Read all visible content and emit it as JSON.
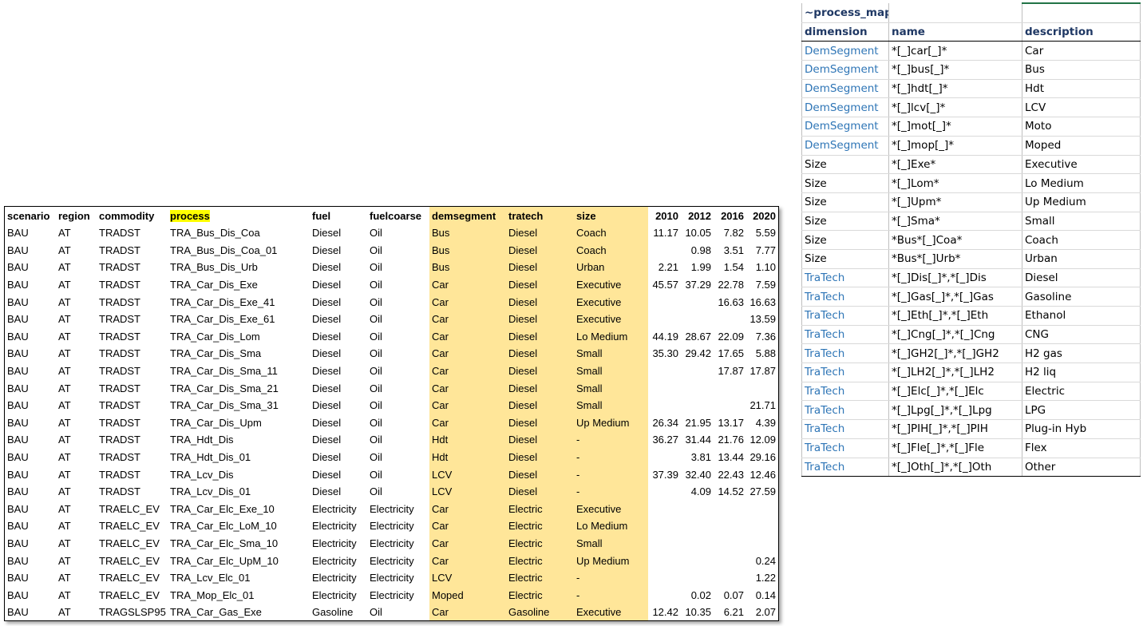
{
  "left_table": {
    "headers": [
      "scenario",
      "region",
      "commodity",
      "process",
      "fuel",
      "fuelcoarse",
      "demsegment",
      "tratech",
      "size",
      "2010",
      "2012",
      "2016",
      "2020"
    ],
    "rows": [
      [
        "BAU",
        "AT",
        "TRADST",
        "TRA_Bus_Dis_Coa",
        "Diesel",
        "Oil",
        "Bus",
        "Diesel",
        "Coach",
        "11.17",
        "10.05",
        "7.82",
        "5.59"
      ],
      [
        "BAU",
        "AT",
        "TRADST",
        "TRA_Bus_Dis_Coa_01",
        "Diesel",
        "Oil",
        "Bus",
        "Diesel",
        "Coach",
        "",
        "0.98",
        "3.51",
        "7.77"
      ],
      [
        "BAU",
        "AT",
        "TRADST",
        "TRA_Bus_Dis_Urb",
        "Diesel",
        "Oil",
        "Bus",
        "Diesel",
        "Urban",
        "2.21",
        "1.99",
        "1.54",
        "1.10"
      ],
      [
        "BAU",
        "AT",
        "TRADST",
        "TRA_Car_Dis_Exe",
        "Diesel",
        "Oil",
        "Car",
        "Diesel",
        "Executive",
        "45.57",
        "37.29",
        "22.78",
        "7.59"
      ],
      [
        "BAU",
        "AT",
        "TRADST",
        "TRA_Car_Dis_Exe_41",
        "Diesel",
        "Oil",
        "Car",
        "Diesel",
        "Executive",
        "",
        "",
        "16.63",
        "16.63"
      ],
      [
        "BAU",
        "AT",
        "TRADST",
        "TRA_Car_Dis_Exe_61",
        "Diesel",
        "Oil",
        "Car",
        "Diesel",
        "Executive",
        "",
        "",
        "",
        "13.59"
      ],
      [
        "BAU",
        "AT",
        "TRADST",
        "TRA_Car_Dis_Lom",
        "Diesel",
        "Oil",
        "Car",
        "Diesel",
        "Lo Medium",
        "44.19",
        "28.67",
        "22.09",
        "7.36"
      ],
      [
        "BAU",
        "AT",
        "TRADST",
        "TRA_Car_Dis_Sma",
        "Diesel",
        "Oil",
        "Car",
        "Diesel",
        "Small",
        "35.30",
        "29.42",
        "17.65",
        "5.88"
      ],
      [
        "BAU",
        "AT",
        "TRADST",
        "TRA_Car_Dis_Sma_11",
        "Diesel",
        "Oil",
        "Car",
        "Diesel",
        "Small",
        "",
        "",
        "17.87",
        "17.87"
      ],
      [
        "BAU",
        "AT",
        "TRADST",
        "TRA_Car_Dis_Sma_21",
        "Diesel",
        "Oil",
        "Car",
        "Diesel",
        "Small",
        "",
        "",
        "",
        ""
      ],
      [
        "BAU",
        "AT",
        "TRADST",
        "TRA_Car_Dis_Sma_31",
        "Diesel",
        "Oil",
        "Car",
        "Diesel",
        "Small",
        "",
        "",
        "",
        "21.71"
      ],
      [
        "BAU",
        "AT",
        "TRADST",
        "TRA_Car_Dis_Upm",
        "Diesel",
        "Oil",
        "Car",
        "Diesel",
        "Up Medium",
        "26.34",
        "21.95",
        "13.17",
        "4.39"
      ],
      [
        "BAU",
        "AT",
        "TRADST",
        "TRA_Hdt_Dis",
        "Diesel",
        "Oil",
        "Hdt",
        "Diesel",
        "-",
        "36.27",
        "31.44",
        "21.76",
        "12.09"
      ],
      [
        "BAU",
        "AT",
        "TRADST",
        "TRA_Hdt_Dis_01",
        "Diesel",
        "Oil",
        "Hdt",
        "Diesel",
        "-",
        "",
        "3.81",
        "13.44",
        "29.16"
      ],
      [
        "BAU",
        "AT",
        "TRADST",
        "TRA_Lcv_Dis",
        "Diesel",
        "Oil",
        "LCV",
        "Diesel",
        "-",
        "37.39",
        "32.40",
        "22.43",
        "12.46"
      ],
      [
        "BAU",
        "AT",
        "TRADST",
        "TRA_Lcv_Dis_01",
        "Diesel",
        "Oil",
        "LCV",
        "Diesel",
        "-",
        "",
        "4.09",
        "14.52",
        "27.59"
      ],
      [
        "BAU",
        "AT",
        "TRAELC_EV",
        "TRA_Car_Elc_Exe_10",
        "Electricity",
        "Electricity",
        "Car",
        "Electric",
        "Executive",
        "",
        "",
        "",
        ""
      ],
      [
        "BAU",
        "AT",
        "TRAELC_EV",
        "TRA_Car_Elc_LoM_10",
        "Electricity",
        "Electricity",
        "Car",
        "Electric",
        "Lo Medium",
        "",
        "",
        "",
        ""
      ],
      [
        "BAU",
        "AT",
        "TRAELC_EV",
        "TRA_Car_Elc_Sma_10",
        "Electricity",
        "Electricity",
        "Car",
        "Electric",
        "Small",
        "",
        "",
        "",
        ""
      ],
      [
        "BAU",
        "AT",
        "TRAELC_EV",
        "TRA_Car_Elc_UpM_10",
        "Electricity",
        "Electricity",
        "Car",
        "Electric",
        "Up Medium",
        "",
        "",
        "",
        "0.24"
      ],
      [
        "BAU",
        "AT",
        "TRAELC_EV",
        "TRA_Lcv_Elc_01",
        "Electricity",
        "Electricity",
        "LCV",
        "Electric",
        "-",
        "",
        "",
        "",
        "1.22"
      ],
      [
        "BAU",
        "AT",
        "TRAELC_EV",
        "TRA_Mop_Elc_01",
        "Electricity",
        "Electricity",
        "Moped",
        "Electric",
        "-",
        "",
        "0.02",
        "0.07",
        "0.14"
      ],
      [
        "BAU",
        "AT",
        "TRAGSLSP95",
        "TRA_Car_Gas_Exe",
        "Gasoline",
        "Oil",
        "Car",
        "Gasoline",
        "Executive",
        "12.42",
        "10.35",
        "6.21",
        "2.07"
      ]
    ]
  },
  "process_map": {
    "title": "~process_map",
    "headers": [
      "dimension",
      "name",
      "description"
    ],
    "rows": [
      [
        "DemSegment",
        "*[_]car[_]*",
        "Car"
      ],
      [
        "DemSegment",
        "*[_]bus[_]*",
        "Bus"
      ],
      [
        "DemSegment",
        "*[_]hdt[_]*",
        "Hdt"
      ],
      [
        "DemSegment",
        "*[_]lcv[_]*",
        "LCV"
      ],
      [
        "DemSegment",
        "*[_]mot[_]*",
        "Moto"
      ],
      [
        "DemSegment",
        "*[_]mop[_]*",
        "Moped"
      ],
      [
        "Size",
        "*[_]Exe*",
        "Executive"
      ],
      [
        "Size",
        "*[_]Lom*",
        "Lo Medium"
      ],
      [
        "Size",
        "*[_]Upm*",
        "Up Medium"
      ],
      [
        "Size",
        "*[_]Sma*",
        "Small"
      ],
      [
        "Size",
        "*Bus*[_]Coa*",
        "Coach"
      ],
      [
        "Size",
        "*Bus*[_]Urb*",
        "Urban"
      ],
      [
        "TraTech",
        "*[_]Dis[_]*,*[_]Dis",
        "Diesel"
      ],
      [
        "TraTech",
        "*[_]Gas[_]*,*[_]Gas",
        "Gasoline"
      ],
      [
        "TraTech",
        "*[_]Eth[_]*,*[_]Eth",
        "Ethanol"
      ],
      [
        "TraTech",
        "*[_]Cng[_]*,*[_]Cng",
        "CNG"
      ],
      [
        "TraTech",
        "*[_]GH2[_]*,*[_]GH2",
        "H2 gas"
      ],
      [
        "TraTech",
        "*[_]LH2[_]*,*[_]LH2",
        "H2 liq"
      ],
      [
        "TraTech",
        "*[_]Elc[_]*,*[_]Elc",
        "Electric"
      ],
      [
        "TraTech",
        "*[_]Lpg[_]*,*[_]Lpg",
        "LPG"
      ],
      [
        "TraTech",
        "*[_]PIH[_]*,*[_]PIH",
        "Plug-in Hyb"
      ],
      [
        "TraTech",
        "*[_]Fle[_]*,*[_]Fle",
        "Flex"
      ],
      [
        "TraTech",
        "*[_]Oth[_]*,*[_]Oth",
        "Other"
      ]
    ]
  },
  "colors": {
    "highlight_columns": "#ffe699",
    "process_header_mark": "#ffff00",
    "dimension_blue": "#2e75b6",
    "header_navy": "#1f3864"
  }
}
